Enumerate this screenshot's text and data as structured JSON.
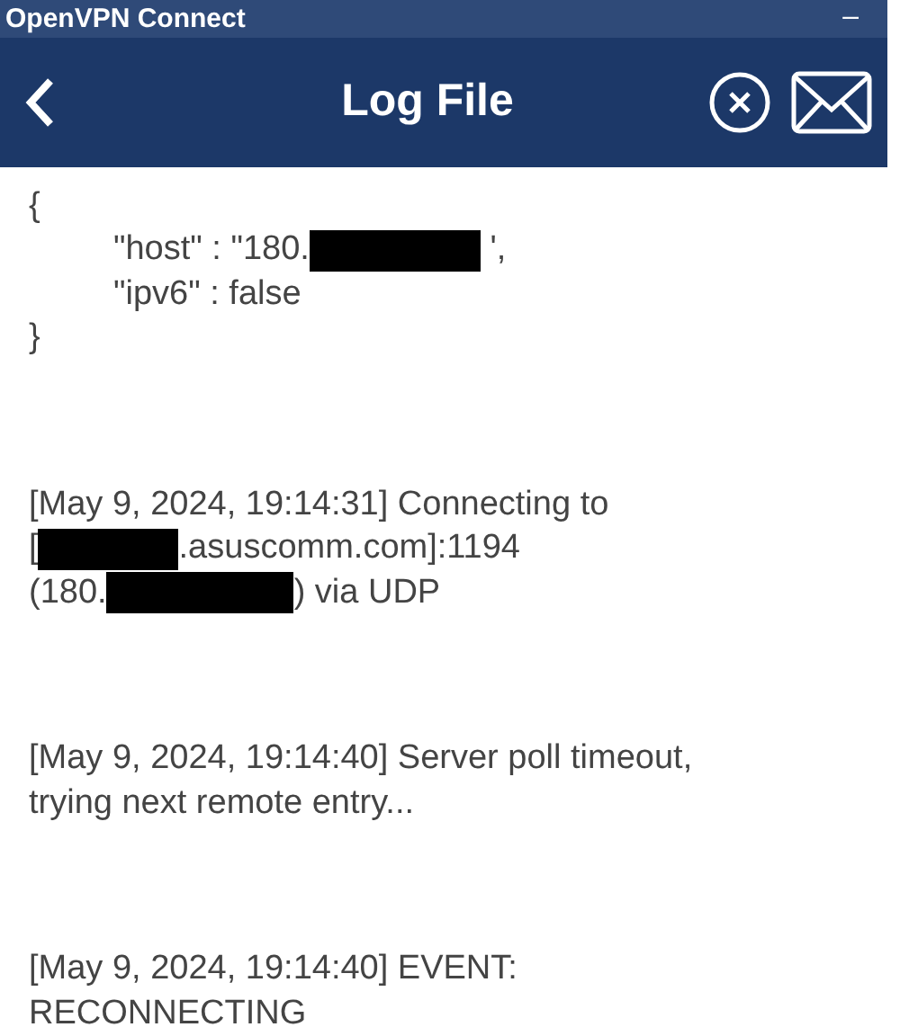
{
  "window": {
    "title": "OpenVPN Connect",
    "minimize": "–"
  },
  "header": {
    "title": "Log File"
  },
  "log": [
    {
      "kind": "object",
      "open": "{",
      "close": "}",
      "children": [
        [
          {
            "kind": "text",
            "text": "\"host\" : \"180."
          },
          {
            "kind": "redacted"
          },
          {
            "kind": "text",
            "text": " ',"
          }
        ],
        [
          {
            "kind": "text",
            "text": "\"ipv6\" : false"
          }
        ]
      ]
    },
    {
      "kind": "message",
      "lines": [
        [
          {
            "kind": "text",
            "text": "[May 9, 2024, 19:14:31] Connecting to"
          }
        ],
        [
          {
            "kind": "text",
            "text": "["
          },
          {
            "kind": "redacted"
          },
          {
            "kind": "text",
            "text": ".asuscomm.com]:1194"
          }
        ],
        [
          {
            "kind": "text",
            "text": "(180."
          },
          {
            "kind": "redacted"
          },
          {
            "kind": "text",
            "text": ") via UDP"
          }
        ]
      ]
    },
    {
      "kind": "message",
      "lines": [
        [
          {
            "kind": "text",
            "text": "[May 9, 2024, 19:14:40] Server poll timeout,"
          }
        ],
        [
          {
            "kind": "text",
            "text": "trying next remote entry..."
          }
        ]
      ]
    },
    {
      "kind": "message",
      "lines": [
        [
          {
            "kind": "text",
            "text": "[May 9, 2024, 19:14:40] EVENT:"
          }
        ],
        [
          {
            "kind": "text",
            "text": "RECONNECTING"
          }
        ]
      ]
    }
  ]
}
